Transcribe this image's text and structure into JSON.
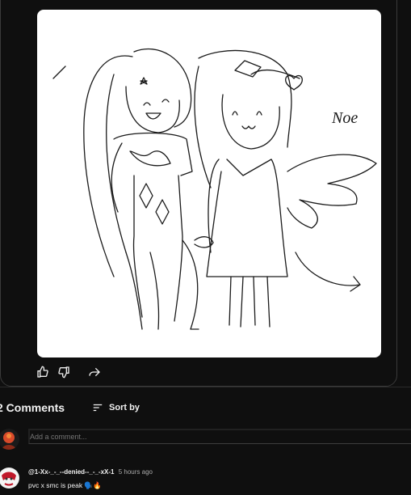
{
  "post": {
    "image_alt": "Sketch of two chibi characters holding hands",
    "signature": "Noe",
    "actions": {
      "like_icon": "thumbs-up-icon",
      "dislike_icon": "thumbs-down-icon",
      "share_icon": "share-icon"
    }
  },
  "comments": {
    "count_label": "2 Comments",
    "sort_label": "Sort by",
    "add_placeholder": "Add a comment...",
    "items": [
      {
        "author": "@1-Xx-_-_--denied--_-_-xX-1",
        "time": "5 hours ago",
        "text": "pvc x smc is peak 🗣️🔥"
      }
    ]
  },
  "colors": {
    "background": "#0f0f0f",
    "text": "#f1f1f1",
    "muted": "#aaaaaa",
    "card_border": "#3a3a3a"
  }
}
